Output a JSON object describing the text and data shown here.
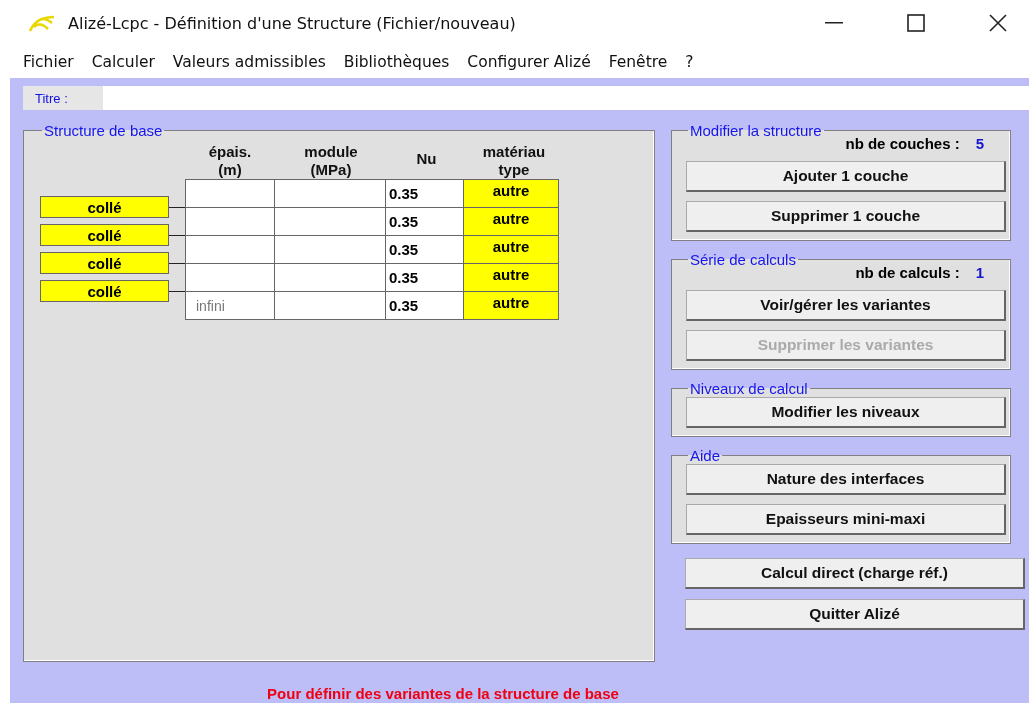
{
  "window": {
    "title": "Alizé-Lcpc - Définition d'une Structure (Fichier/nouveau)"
  },
  "menu": [
    "Fichier",
    "Calculer",
    "Valeurs admissibles",
    "Bibliothèques",
    "Configurer Alizé",
    "Fenêtre",
    "?"
  ],
  "title_field": {
    "label": "Titre :"
  },
  "structure": {
    "legend": "Structure de base",
    "columns": [
      "épais.\n(m)",
      "module\n(MPa)",
      "Nu",
      "matériau\ntype"
    ],
    "interfaces": [
      "collé",
      "collé",
      "collé",
      "collé"
    ],
    "layers": [
      {
        "nu": "0.35",
        "material": "autre"
      },
      {
        "nu": "0.35",
        "material": "autre"
      },
      {
        "nu": "0.35",
        "material": "autre"
      },
      {
        "nu": "0.35",
        "material": "autre"
      },
      {
        "thickness": "infini",
        "nu": "0.35",
        "material": "autre"
      }
    ]
  },
  "groups": [
    {
      "legend": "Modifier la structure",
      "counter_label": "nb de couches :",
      "counter_value": "5",
      "buttons": [
        {
          "label": "Ajouter 1 couche",
          "disabled": false
        },
        {
          "label": "Supprimer 1 couche",
          "disabled": false
        }
      ]
    },
    {
      "legend": "Série de calculs",
      "counter_label": "nb de calculs :",
      "counter_value": "1",
      "buttons": [
        {
          "label": "Voir/gérer les variantes",
          "disabled": false
        },
        {
          "label": "Supprimer les variantes",
          "disabled": true
        }
      ]
    },
    {
      "legend": "Niveaux de calcul",
      "buttons": [
        {
          "label": "Modifier les niveaux",
          "disabled": false
        }
      ]
    },
    {
      "legend": "Aide",
      "buttons": [
        {
          "label": "Nature des interfaces",
          "disabled": false
        },
        {
          "label": "Epaisseurs mini-maxi",
          "disabled": false
        }
      ]
    }
  ],
  "actions": [
    {
      "label": "Calcul direct (charge réf.)",
      "disabled": false
    },
    {
      "label": "Quitter Alizé",
      "disabled": false
    }
  ],
  "message": "Pour définir des variantes de la structure de base"
}
